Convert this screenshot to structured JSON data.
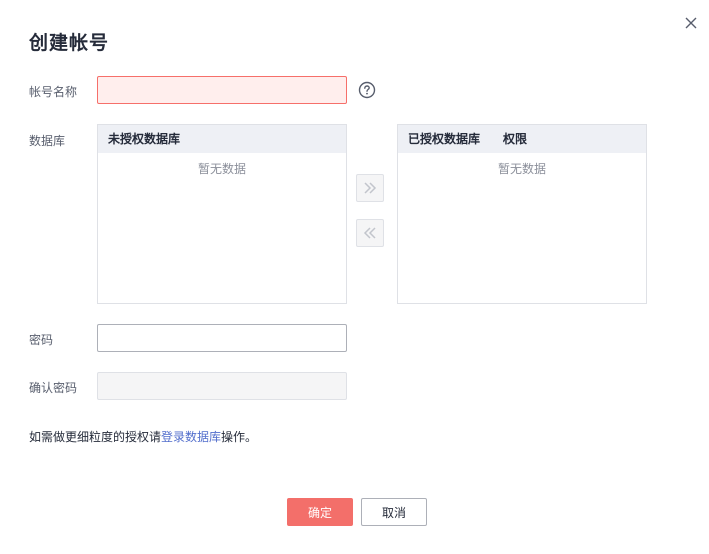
{
  "dialog": {
    "title": "创建帐号"
  },
  "form": {
    "account_name_label": "帐号名称",
    "account_name_value": "",
    "database_label": "数据库",
    "password_label": "密码",
    "password_value": "",
    "confirm_password_label": "确认密码",
    "confirm_password_value": ""
  },
  "transfer": {
    "left_header": "未授权数据库",
    "left_empty": "暂无数据",
    "right_header": "已授权数据库",
    "right_header_col2": "权限",
    "right_empty": "暂无数据"
  },
  "hint": {
    "prefix": "如需做更细粒度的授权请",
    "link": "登录数据库",
    "suffix": "操作。"
  },
  "footer": {
    "ok_label": "确定",
    "cancel_label": "取消"
  },
  "icons": {
    "close": "close-icon",
    "help": "help-icon",
    "move_right": "double-chevron-right-icon",
    "move_left": "double-chevron-left-icon"
  },
  "colors": {
    "primary": "#f36f6a",
    "link": "#526ecc",
    "error_bg": "#ffeeed"
  }
}
